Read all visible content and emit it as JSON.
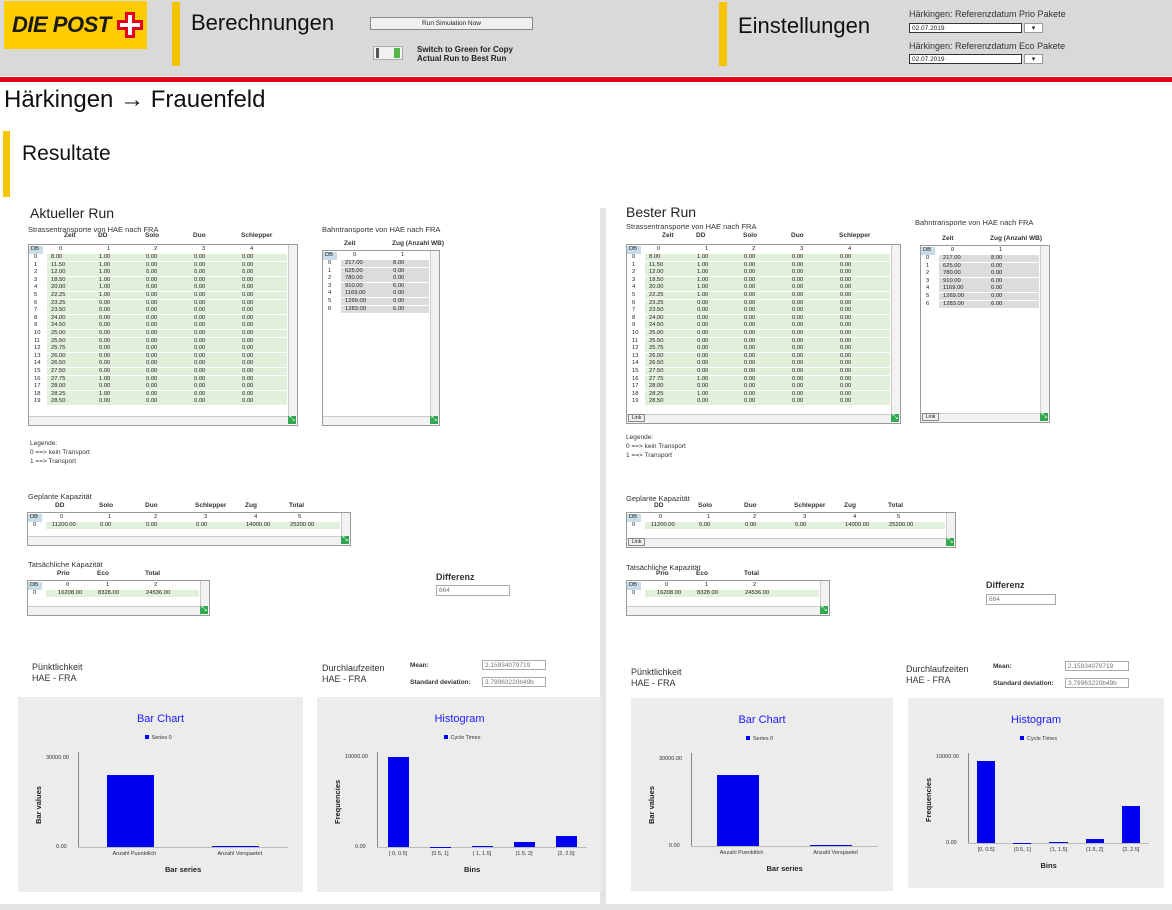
{
  "header": {
    "logo_text": "DIE POST",
    "berechnungen": "Berechnungen",
    "run_button": "Run Simulation Now",
    "switch_text_1": "Switch to Green for Copy",
    "switch_text_2": "Actual Run to Best Run",
    "einstellungen": "Einstellungen",
    "prio_label": "Härkingen: Referenzdatum Prio Pakete",
    "prio_date": "02.07.2019",
    "eco_label": "Härkingen: Referenzdatum Eco Pakete",
    "eco_date": "02.07.2019"
  },
  "colors": {
    "brand_yellow": "#ffcc00",
    "brand_red": "#e2001a",
    "accent_bar": "#f5c400",
    "chart_blue": "#0000ee",
    "grid_green": "#e2efda"
  },
  "route_title": "Härkingen → Frauenfeld",
  "section_title": "Resultate",
  "legend_text": {
    "title": "Legende:",
    "l0": "0 ==> kein Transport",
    "l1": "1 ==> Transport"
  },
  "strasse_cols": [
    "Zeit",
    "DD",
    "Solo",
    "Duo",
    "Schlepper"
  ],
  "strasse_idx": [
    "DB",
    "0",
    "1",
    "2",
    "3",
    "4"
  ],
  "strasse_rows": [
    [
      "0",
      "8.00",
      "1.00",
      "0.00",
      "0.00",
      "0.00"
    ],
    [
      "1",
      "11.50",
      "1.00",
      "0.00",
      "0.00",
      "0.00"
    ],
    [
      "2",
      "12.00",
      "1.00",
      "0.00",
      "0.00",
      "0.00"
    ],
    [
      "3",
      "18.50",
      "1.00",
      "0.00",
      "0.00",
      "0.00"
    ],
    [
      "4",
      "20.00",
      "1.00",
      "0.00",
      "0.00",
      "0.00"
    ],
    [
      "5",
      "22.25",
      "1.00",
      "0.00",
      "0.00",
      "0.00"
    ],
    [
      "6",
      "23.25",
      "0.00",
      "0.00",
      "0.00",
      "0.00"
    ],
    [
      "7",
      "23.50",
      "0.00",
      "0.00",
      "0.00",
      "0.00"
    ],
    [
      "8",
      "24.00",
      "0.00",
      "0.00",
      "0.00",
      "0.00"
    ],
    [
      "9",
      "24.50",
      "0.00",
      "0.00",
      "0.00",
      "0.00"
    ],
    [
      "10",
      "25.00",
      "0.00",
      "0.00",
      "0.00",
      "0.00"
    ],
    [
      "11",
      "25.50",
      "0.00",
      "0.00",
      "0.00",
      "0.00"
    ],
    [
      "12",
      "25.75",
      "0.00",
      "0.00",
      "0.00",
      "0.00"
    ],
    [
      "13",
      "26.00",
      "0.00",
      "0.00",
      "0.00",
      "0.00"
    ],
    [
      "14",
      "26.50",
      "0.00",
      "0.00",
      "0.00",
      "0.00"
    ],
    [
      "15",
      "27.50",
      "0.00",
      "0.00",
      "0.00",
      "0.00"
    ],
    [
      "16",
      "27.75",
      "1.00",
      "0.00",
      "0.00",
      "0.00"
    ],
    [
      "17",
      "28.00",
      "0.00",
      "0.00",
      "0.00",
      "0.00"
    ],
    [
      "18",
      "28.25",
      "1.00",
      "0.00",
      "0.00",
      "0.00"
    ],
    [
      "19",
      "28.50",
      "0.00",
      "0.00",
      "0.00",
      "0.00"
    ]
  ],
  "bahn_cols": [
    "Zeit",
    "Zug (Anzahl WB)"
  ],
  "bahn_idx": [
    "DB",
    "0",
    "1"
  ],
  "bahn_rows": [
    [
      "0",
      "217.00",
      "8.00"
    ],
    [
      "1",
      "625.00",
      "0.00"
    ],
    [
      "2",
      "780.00",
      "0.00"
    ],
    [
      "3",
      "910.00",
      "6.00"
    ],
    [
      "4",
      "1169.00",
      "0.00"
    ],
    [
      "5",
      "1269.00",
      "0.00"
    ],
    [
      "6",
      "1283.00",
      "6.00"
    ]
  ],
  "kap_cols": [
    "DD",
    "Solo",
    "Duo",
    "Schlepper",
    "Zug",
    "Total"
  ],
  "kap_idx": [
    "DB",
    "0",
    "1",
    "2",
    "3",
    "4",
    "5"
  ],
  "kap_row": [
    "0",
    "11200.00",
    "0.00",
    "0.00",
    "0.00",
    "14000.00",
    "25200.00"
  ],
  "tat_cols": [
    "Prio",
    "Eco",
    "Total"
  ],
  "tat_idx": [
    "DB",
    "0",
    "1",
    "2"
  ],
  "tat_row": [
    "0",
    "16208.00",
    "8328.00",
    "24536.00"
  ],
  "link_label": "Link",
  "left": {
    "title": "Aktueller Run",
    "strasse_title": "Strassentransporte von HAE nach FRA",
    "bahn_title": "Bahntransporte von HAE nach FRA",
    "kap_title": "Geplante Kapazität",
    "tat_title": "Tatsächliche Kapazität",
    "diff_label": "Differenz",
    "diff_value": "664",
    "punkt_title_1": "Pünktlichkeit",
    "punkt_title_2": "HAE - FRA",
    "durch_title_1": "Durchlaufzeiten",
    "durch_title_2": "HAE - FRA",
    "mean_label": "Mean:",
    "mean_value": "2.15934079719",
    "std_label": "Standard deviation:",
    "std_value": "3.79963220b49b"
  },
  "right": {
    "title": "Bester Run",
    "strasse_title": "Strassentransporte von HAE nach FRA",
    "bahn_title": "Bahntransporte von HAE nach FRA",
    "kap_title": "Geplante Kapazität",
    "tat_title": "Tatsächliche Kapazität",
    "diff_label": "Differenz",
    "diff_value": "664",
    "punkt_title_1": "Pünktlichkeit",
    "punkt_title_2": "HAE - FRA",
    "durch_title_1": "Durchlaufzeiten",
    "durch_title_2": "HAE - FRA",
    "mean_label": "Mean:",
    "mean_value": "2.15934079719",
    "std_label": "Standard deviation:",
    "std_value": "3.79963220b49b"
  },
  "chart_data": [
    {
      "type": "bar",
      "title": "Bar Chart",
      "legend": "Series 0",
      "xlabel": "Bar series",
      "ylabel": "Bar values",
      "categories": [
        "Anzahl Puenktlich",
        "Anzahl Verspaetet"
      ],
      "values": [
        24300,
        400
      ],
      "ylim": [
        0,
        32000
      ],
      "yticks": [
        "30000.00",
        "0.00"
      ]
    },
    {
      "type": "bar",
      "title": "Histogram",
      "legend": "Cycle Times",
      "xlabel": "Bins",
      "ylabel": "Frequencies",
      "categories": [
        "[ 0, 0.5]",
        "(0.5, 1]",
        "( 1, 1.5]",
        "(1.5, 2]",
        "(2, 2.5]"
      ],
      "values": [
        10000,
        0,
        60,
        600,
        1200
      ],
      "ylim": [
        0,
        10500
      ],
      "yticks": [
        "10000.00",
        "0.00"
      ]
    },
    {
      "type": "bar",
      "title": "Bar Chart",
      "legend": "Series 0",
      "xlabel": "Bar series",
      "ylabel": "Bar values",
      "categories": [
        "Anzahl Puenktlich",
        "Anzahl Verspaetet"
      ],
      "values": [
        24300,
        400
      ],
      "ylim": [
        0,
        32000
      ],
      "yticks": [
        "30000.00",
        "0.00"
      ]
    },
    {
      "type": "bar",
      "title": "Histogram",
      "legend": "Cycle Times",
      "xlabel": "Bins",
      "ylabel": "Frequencies",
      "categories": [
        "[0, 0.5]",
        "(0.5, 1]",
        "(1, 1.5]",
        "(1.5, 2]",
        "(2, 2.5]"
      ],
      "values": [
        9600,
        0,
        60,
        500,
        4300
      ],
      "ylim": [
        0,
        10500
      ],
      "yticks": [
        "10000.00",
        "0.00"
      ]
    }
  ]
}
